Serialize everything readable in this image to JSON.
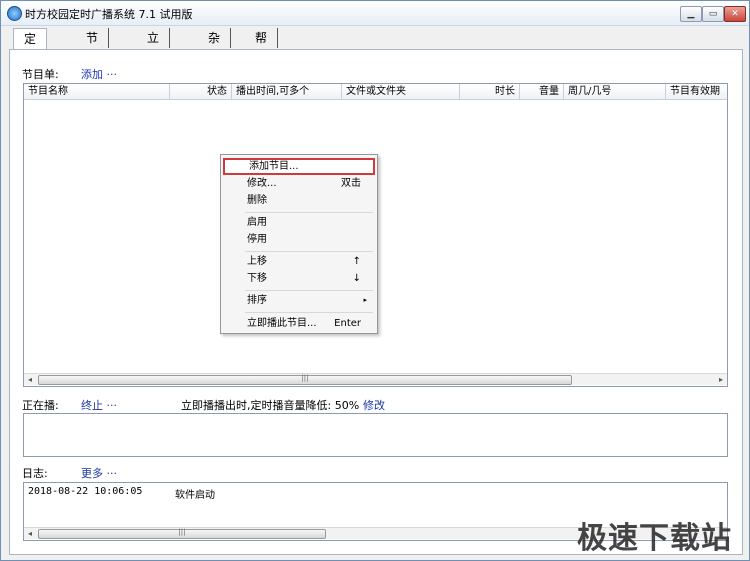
{
  "window": {
    "title": "时方校园定时广播系统 7.1 试用版"
  },
  "tabs": [
    {
      "label": "定时播"
    },
    {
      "label": "节假日"
    },
    {
      "label": "立即播"
    },
    {
      "label": "杂项"
    },
    {
      "label": "帮助~咨询专家"
    }
  ],
  "programs": {
    "label": "节目单:",
    "add_link": "添加",
    "more_dots": "···",
    "columns": [
      "节目名称",
      "状态",
      "播出时间,可多个",
      "文件或文件夹",
      "时长",
      "音量",
      "周几/几号",
      "节目有效期"
    ]
  },
  "context_menu": {
    "items": [
      {
        "label": "添加节目...",
        "key": ""
      },
      {
        "label": "修改...",
        "key": "双击"
      },
      {
        "label": "删除",
        "key": ""
      },
      {
        "label": "启用",
        "key": ""
      },
      {
        "label": "停用",
        "key": ""
      },
      {
        "label": "上移",
        "key": "↑"
      },
      {
        "label": "下移",
        "key": "↓"
      },
      {
        "label": "排序",
        "key": "▸"
      },
      {
        "label": "立即播此节目...",
        "key": "Enter"
      }
    ]
  },
  "playing": {
    "label": "正在播:",
    "stop_link": "终止",
    "more_dots": "···",
    "notice": "立即播播出时,定时播音量降低: 50%",
    "modify_link": "修改"
  },
  "log": {
    "label": "日志:",
    "more_link": "更多",
    "more_dots": "···",
    "entries": [
      {
        "time": "2018-08-22 10:06:05",
        "message": "软件启动"
      }
    ]
  },
  "watermark": "极速下载站"
}
